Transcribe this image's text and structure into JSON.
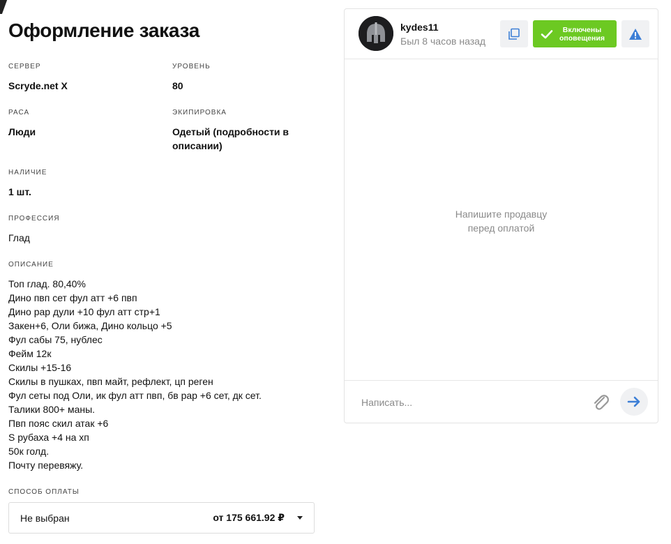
{
  "order": {
    "title": "Оформление заказа",
    "fields": {
      "server": {
        "label": "СЕРВЕР",
        "value": "Scryde.net X"
      },
      "level": {
        "label": "УРОВЕНЬ",
        "value": "80"
      },
      "race": {
        "label": "РАСА",
        "value": "Люди"
      },
      "equipment": {
        "label": "ЭКИПИРОВКА",
        "value": "Одетый (подробности в описании)"
      },
      "stock": {
        "label": "НАЛИЧИЕ",
        "value": "1 шт."
      },
      "profession": {
        "label": "ПРОФЕССИЯ",
        "value": "Глад"
      }
    },
    "description": {
      "label": "ОПИСАНИЕ",
      "lines": [
        "Топ глад. 80,40%",
        "Дино пвп сет фул атт +6 пвп",
        "Дино рар дули +10 фул атт стр+1",
        "Закен+6, Оли бижа, Дино кольцо +5",
        "Фул сабы 75, нублес",
        "Фейм 12к",
        "Скилы +15-16",
        "Скилы в пушках, пвп майт, рефлект, цп реген",
        "Фул сеты под Оли, ик фул атт пвп, бв рар +6 сет, дк сет.",
        "Талики 800+ маны.",
        "Пвп пояс скил атак +6",
        "S рубаха +4 на хп",
        "50к голд.",
        "Почту перевяжу."
      ]
    },
    "payment": {
      "label": "СПОСОБ ОПЛАТЫ",
      "selected": "Не выбран",
      "price": "от 175 661.92 ₽"
    }
  },
  "chat": {
    "seller": {
      "username": "kydes11",
      "last_seen": "Был 8 часов назад"
    },
    "notifications_label_line1": "Включены",
    "notifications_label_line2": "оповещения",
    "empty_line1": "Напишите продавцу",
    "empty_line2": "перед оплатой",
    "input_placeholder": "Написать..."
  },
  "colors": {
    "accent_green": "#6cc922",
    "accent_blue": "#3d7fd6",
    "muted_text": "#8a8a8a"
  },
  "icons": {
    "copy": "copy-icon",
    "check": "check-icon",
    "report": "warning-icon",
    "attach": "paperclip-icon",
    "send": "arrow-right-icon",
    "avatar": "spartan-helmet-icon"
  }
}
